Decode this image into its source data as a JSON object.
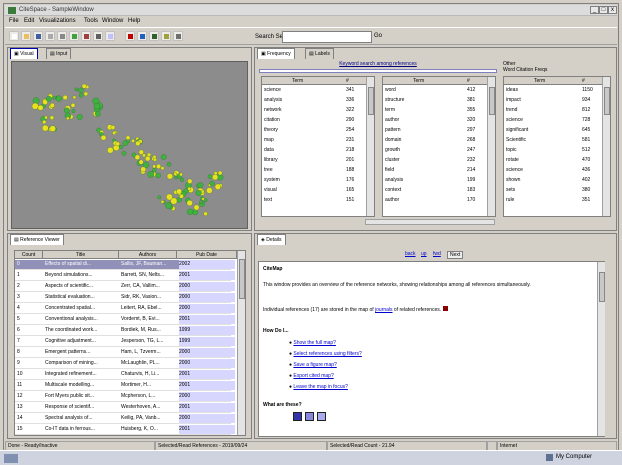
{
  "window": {
    "title": "CiteSpace - SampleWindow",
    "controls": [
      "_",
      "□",
      "x"
    ]
  },
  "menu": {
    "items": [
      "File",
      "Edit",
      "Visualizations",
      "Tools",
      "Window",
      "Help"
    ]
  },
  "toolbar": {
    "search_label": "Search Search",
    "search_value": "",
    "go_label": "Go",
    "icons": [
      "new-icon",
      "open-icon",
      "save-icon",
      "select-icon",
      "move-icon",
      "zoom-in-icon",
      "zoom-out-icon",
      "print-icon",
      "copy-icon",
      "stop-icon",
      "run-icon",
      "chart-icon",
      "export-icon",
      "config-icon"
    ]
  },
  "left_top": {
    "tabs": [
      "Visual",
      "Input"
    ],
    "accent": "#0000aa"
  },
  "right_top": {
    "tabs": [
      "Frequency",
      "Labels"
    ],
    "filter_header": "Keyword search among references",
    "col1": {
      "title": "",
      "hdr": [
        "Term",
        "#"
      ],
      "rows": [
        [
          "science",
          "341"
        ],
        [
          "analysis",
          "336"
        ],
        [
          "network",
          "322"
        ],
        [
          "citation",
          "290"
        ],
        [
          "theory",
          "254"
        ],
        [
          "map",
          "231"
        ],
        [
          "data",
          "218"
        ],
        [
          "library",
          "201"
        ],
        [
          "tree",
          "188"
        ],
        [
          "system",
          "176"
        ],
        [
          "visual",
          "165"
        ],
        [
          "text",
          "151"
        ]
      ]
    },
    "col2": {
      "title": "",
      "hdr": [
        "Term",
        "#"
      ],
      "rows": [
        [
          "word",
          "412"
        ],
        [
          "structure",
          "381"
        ],
        [
          "term",
          "355"
        ],
        [
          "author",
          "320"
        ],
        [
          "pattern",
          "297"
        ],
        [
          "domain",
          "268"
        ],
        [
          "growth",
          "247"
        ],
        [
          "cluster",
          "232"
        ],
        [
          "field",
          "214"
        ],
        [
          "analysis",
          "199"
        ],
        [
          "context",
          "183"
        ],
        [
          "author",
          "170"
        ]
      ]
    },
    "col3": {
      "title": "Other",
      "subtitle": "Word Citation Freqs",
      "hdr": [
        "Term",
        "#"
      ],
      "rows": [
        [
          "ideas",
          "1150"
        ],
        [
          "impact",
          "934"
        ],
        [
          "trend",
          "812"
        ],
        [
          "science",
          "728"
        ],
        [
          "significant",
          "645"
        ],
        [
          "Scientific",
          "581"
        ],
        [
          "topic",
          "512"
        ],
        [
          "rotate",
          "470"
        ],
        [
          "science",
          "436"
        ],
        [
          "shown",
          "402"
        ],
        [
          "sets",
          "380"
        ],
        [
          "rule",
          "351"
        ]
      ]
    }
  },
  "left_bottom": {
    "tab": "Reference Viewer",
    "cols": [
      "Count",
      "Title",
      "Authors",
      "Pub Date"
    ],
    "rows": [
      [
        "0",
        "Effects of spatial di...",
        "Sallis, JF, Bauman...",
        "2002"
      ],
      [
        "1",
        "Beyond simulations...",
        "Barrett, SN, Nelts...",
        "2001"
      ],
      [
        "2",
        "Aspects of scientific...",
        "Zerr, CA, Vallim...",
        "2000"
      ],
      [
        "3",
        "Statistical evaluation...",
        "Sidr, RK, Vasion...",
        "2000"
      ],
      [
        "4",
        "Concentrated spatial...",
        "Leitert, RA, Ebel...",
        "2000"
      ],
      [
        "5",
        "Conventional analysis...",
        "Vordemt, B, Evi...",
        "2001"
      ],
      [
        "6",
        "The coordinated work...",
        "Bordiek, M, Rus...",
        "1999"
      ],
      [
        "7",
        "Cognitive adjustment...",
        "Jesperson, TG, L...",
        "1999"
      ],
      [
        "8",
        "Emergent patterns...",
        "Ham, L, Tzverm...",
        "2000"
      ],
      [
        "9",
        "Comparison of mining...",
        "McLaughlin, PL...",
        "2000"
      ],
      [
        "10",
        "Integrated refinement...",
        "Chaturvis, H, Li...",
        "2001"
      ],
      [
        "11",
        "Multiscale modelling...",
        "Mortimer, H...",
        "2001"
      ],
      [
        "12",
        "Fort Myers public sit...",
        "Mcpherson, L...",
        "2000"
      ],
      [
        "13",
        "Response of scientif...",
        "Westerhoven, A...",
        "2001"
      ],
      [
        "14",
        "Spectral analysis of...",
        "Keilig, PA, Vanb...",
        "2000"
      ],
      [
        "15",
        "Co-IT data in ferrous...",
        "Huisberg, K, O...",
        "2001"
      ]
    ]
  },
  "right_bottom": {
    "tab": "Details",
    "nav": [
      "back",
      "up",
      "fwd",
      "Next"
    ],
    "heading": "CiteMap",
    "intro": "This window provides an overview of the reference networks, showing relationships among all references simultaneously.",
    "para2_a": "Individual references (17) are stored in the map of",
    "para2_link": "journals",
    "para2_b": "of related references.",
    "howto_title": "How Do I...",
    "howto_links": [
      "Show the full map?",
      "Select references using filters?",
      "Save a figure map?",
      "Export cited map?",
      "Leave the map in focus?"
    ],
    "whatare_title": "What are these?"
  },
  "status": {
    "cells": [
      "Done - Ready/Inactive",
      "Selected/Read References - 2019/09/24",
      "Selected/Read Count - 21.94",
      "",
      "Internet"
    ]
  },
  "taskbar": {
    "right": "My Computer"
  }
}
